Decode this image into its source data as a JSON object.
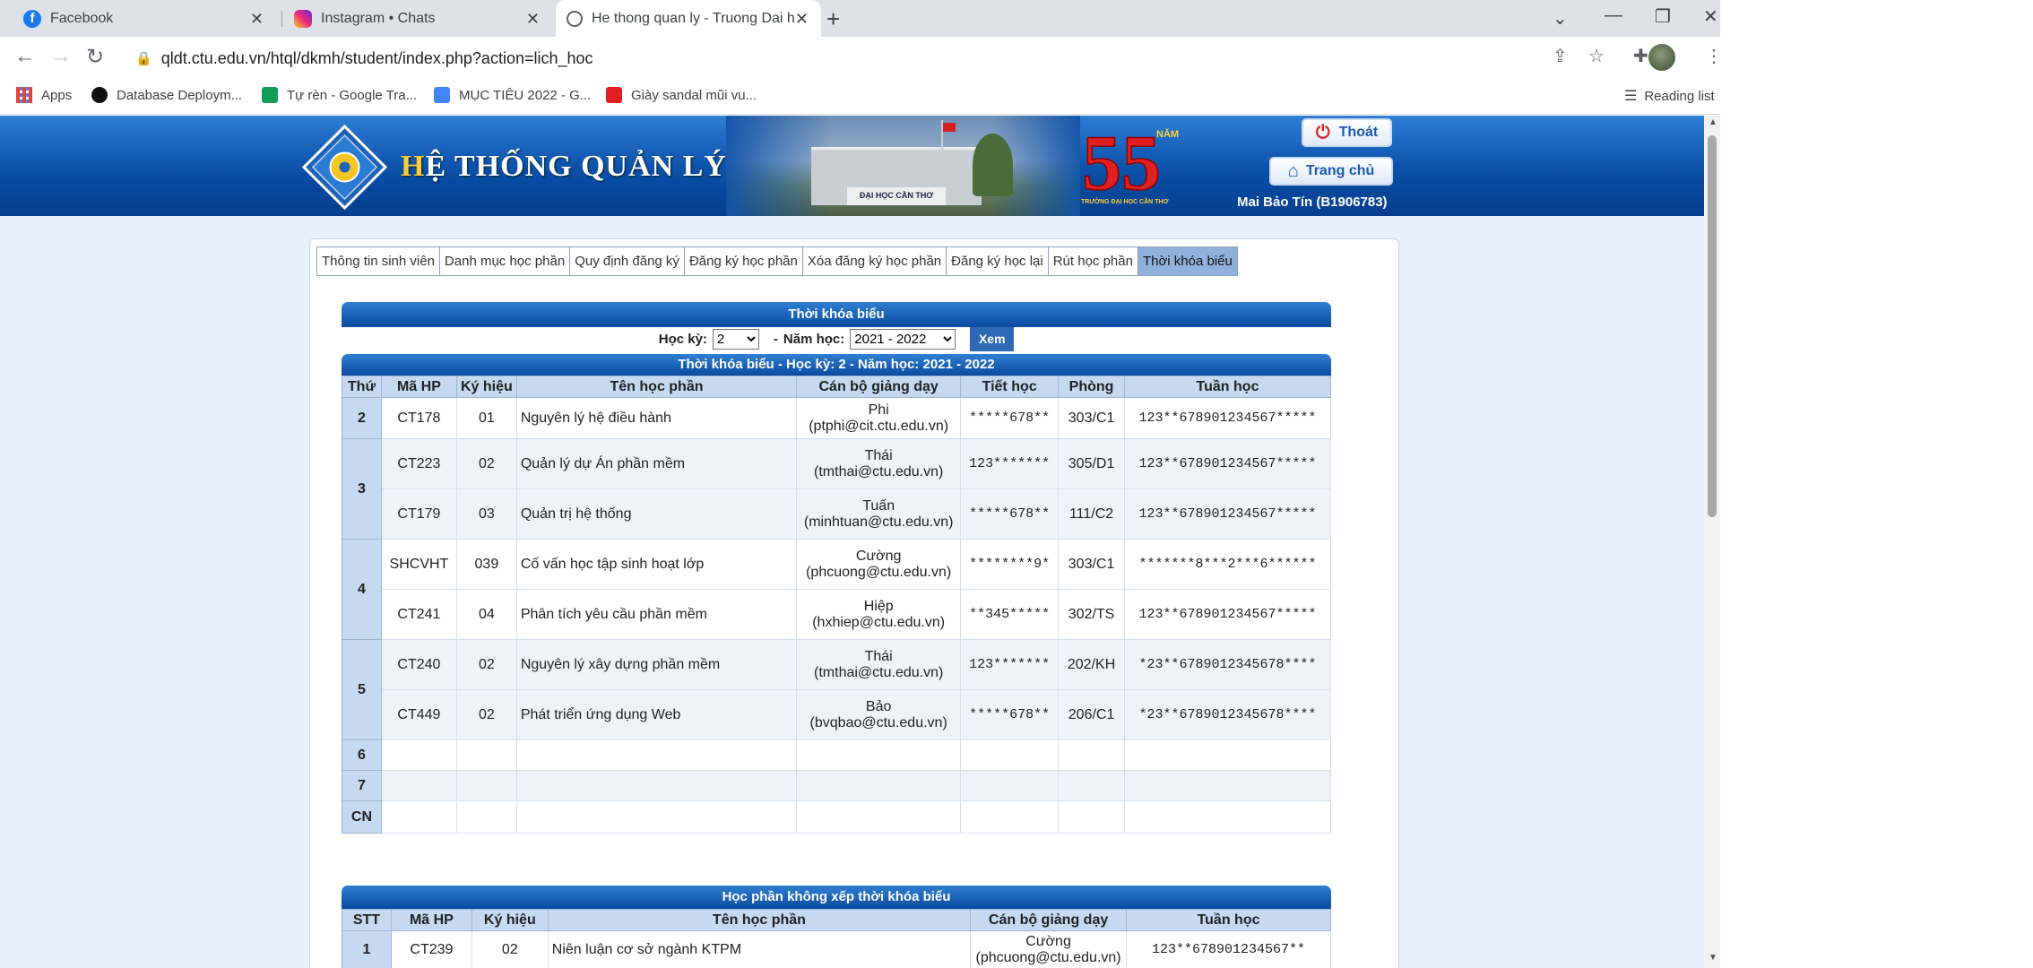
{
  "browser": {
    "tabs": [
      {
        "title": "Facebook",
        "icon": "facebook-icon",
        "active": false
      },
      {
        "title": "Instagram • Chats",
        "icon": "instagram-icon",
        "active": false
      },
      {
        "title": "He thong quan ly - Truong Dai h",
        "icon": "globe-icon",
        "active": true
      }
    ],
    "url": "qldt.ctu.edu.vn/htql/dkmh/student/index.php?action=lich_hoc",
    "bookmarks": [
      {
        "label": "Apps",
        "icon": "apps-grid-icon"
      },
      {
        "label": "Database Deploym...",
        "icon": "mongodb-icon"
      },
      {
        "label": "Tự rèn - Google Tra...",
        "icon": "google-sheets-icon"
      },
      {
        "label": "MỤC TIÊU 2022 - G...",
        "icon": "google-docs-icon"
      },
      {
        "label": "Giày sandal mũi vu...",
        "icon": "shop-icon"
      }
    ],
    "reading_list": "Reading list"
  },
  "header": {
    "title_first": "H",
    "title_rest": "Ệ THỐNG QUẢN LÝ",
    "logout": "Thoát",
    "home": "Trang chủ",
    "user": "Mai Bảo Tín (B1906783)",
    "campus_sign": "ĐẠI HỌC CẦN THƠ",
    "badge_number": "55",
    "badge_year": "NĂM",
    "badge_caption": "TRƯỜNG ĐẠI HỌC CẦN THƠ"
  },
  "menu": [
    "Thông tin sinh viên",
    "Danh mục học phần",
    "Quy định đăng ký",
    "Đăng ký học phần",
    "Xóa đăng ký học phần",
    "Đăng ký học lại",
    "Rút học phần",
    "Thời khóa biểu"
  ],
  "menu_active_index": 7,
  "schedule": {
    "title": "Thời khóa biểu",
    "semester_label": "Học kỳ:",
    "semester_value": "2",
    "year_label": "Năm học:",
    "year_value": "2021 - 2022",
    "view_button": "Xem",
    "subtitle": "Thời khóa biểu - Học kỳ: 2 - Năm học: 2021 - 2022",
    "headers": [
      "Thứ",
      "Mã HP",
      "Ký hiệu",
      "Tên học phần",
      "Cán bộ giảng dạy",
      "Tiết học",
      "Phòng",
      "Tuần học"
    ],
    "days": [
      {
        "day": "2",
        "rows": [
          {
            "code": "CT178",
            "group": "01",
            "name": "Nguyên lý hệ điều hành",
            "lecturer": "Phi",
            "email": "(ptphi@cit.ctu.edu.vn)",
            "periods": "*****678**",
            "room": "303/C1",
            "weeks": "123**678901234567*****"
          }
        ]
      },
      {
        "day": "3",
        "rows": [
          {
            "code": "CT223",
            "group": "02",
            "name": "Quản lý dự Án phần mềm",
            "lecturer": "Thái",
            "email": "(tmthai@ctu.edu.vn)",
            "periods": "123*******",
            "room": "305/D1",
            "weeks": "123**678901234567*****"
          },
          {
            "code": "CT179",
            "group": "03",
            "name": "Quản trị hệ thống",
            "lecturer": "Tuấn",
            "email": "(minhtuan@ctu.edu.vn)",
            "periods": "*****678**",
            "room": "111/C2",
            "weeks": "123**678901234567*****"
          }
        ]
      },
      {
        "day": "4",
        "rows": [
          {
            "code": "SHCVHT",
            "group": "039",
            "name": "Cố vấn học tập sinh hoạt lớp",
            "lecturer": "Cường",
            "email": "(phcuong@ctu.edu.vn)",
            "periods": "********9*",
            "room": "303/C1",
            "weeks": "*******8***2***6******"
          },
          {
            "code": "CT241",
            "group": "04",
            "name": "Phân tích yêu cầu phần mềm",
            "lecturer": "Hiệp",
            "email": "(hxhiep@ctu.edu.vn)",
            "periods": "**345*****",
            "room": "302/TS",
            "weeks": "123**678901234567*****"
          }
        ]
      },
      {
        "day": "5",
        "rows": [
          {
            "code": "CT240",
            "group": "02",
            "name": "Nguyên lý xây dựng phần mềm",
            "lecturer": "Thái",
            "email": "(tmthai@ctu.edu.vn)",
            "periods": "123*******",
            "room": "202/KH",
            "weeks": "*23**6789012345678****"
          },
          {
            "code": "CT449",
            "group": "02",
            "name": "Phát triển ứng dụng Web",
            "lecturer": "Bảo",
            "email": "(bvqbao@ctu.edu.vn)",
            "periods": "*****678**",
            "room": "206/C1",
            "weeks": "*23**6789012345678****"
          }
        ]
      },
      {
        "day": "6",
        "rows": []
      },
      {
        "day": "7",
        "rows": []
      },
      {
        "day": "CN",
        "rows": []
      }
    ]
  },
  "unscheduled": {
    "title": "Học phần không xếp thời khóa biểu",
    "headers": [
      "STT",
      "Mã HP",
      "Ký hiệu",
      "Tên học phần",
      "Cán bộ giảng dạy",
      "Tuần học"
    ],
    "rows": [
      {
        "stt": "1",
        "code": "CT239",
        "group": "02",
        "name": "Niên luận cơ sở ngành KTPM",
        "lecturer": "Cường",
        "email": "(phcuong@ctu.edu.vn)",
        "weeks": "123**678901234567**"
      }
    ]
  },
  "colors": {
    "header_blue": "#0a4fa8",
    "panel_bg": "#e6f0fb",
    "table_header": "#c5d9f1",
    "active_menu": "#8fb1dc"
  }
}
